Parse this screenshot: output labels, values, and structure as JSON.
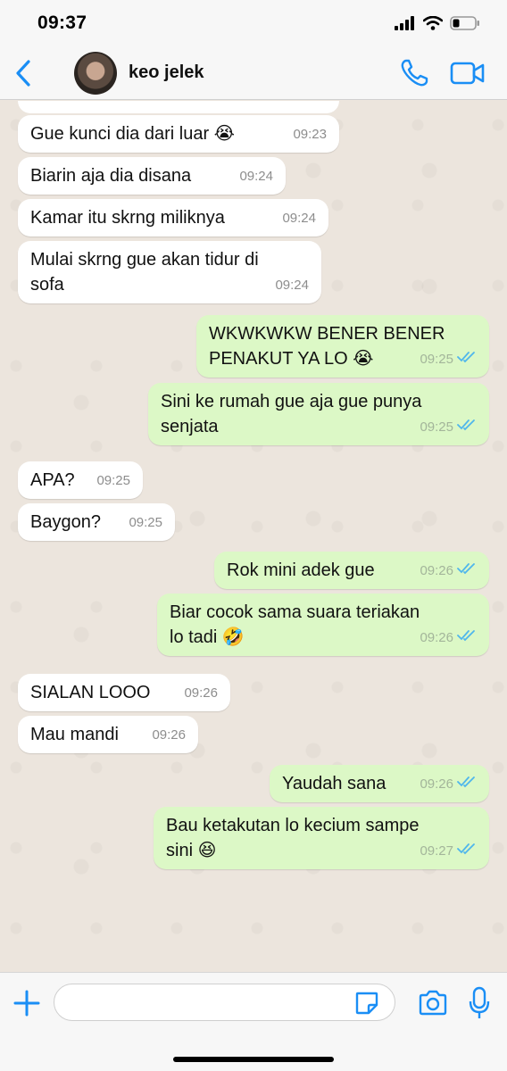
{
  "status_bar": {
    "time": "09:37"
  },
  "header": {
    "contact_name": "keo jelek"
  },
  "messages": [
    {
      "dir": "in",
      "lines": [
        "Gue kunci dia dari luar 😭"
      ],
      "time": "09:23"
    },
    {
      "dir": "in",
      "lines": [
        "Biarin aja dia disana"
      ],
      "time": "09:24"
    },
    {
      "dir": "in",
      "lines": [
        "Kamar itu skrng miliknya"
      ],
      "time": "09:24"
    },
    {
      "dir": "in",
      "lines": [
        "Mulai skrng gue akan tidur di",
        "sofa"
      ],
      "time": "09:24"
    },
    {
      "dir": "out",
      "lines": [
        "WKWKWKW BENER BENER",
        "PENAKUT YA LO 😭"
      ],
      "time": "09:25"
    },
    {
      "dir": "out",
      "lines": [
        "Sini ke rumah gue aja gue punya",
        "senjata"
      ],
      "time": "09:25"
    },
    {
      "dir": "in",
      "lines": [
        "APA?"
      ],
      "time": "09:25"
    },
    {
      "dir": "in",
      "lines": [
        "Baygon?"
      ],
      "time": "09:25"
    },
    {
      "dir": "out",
      "lines": [
        "Rok mini adek gue"
      ],
      "time": "09:26"
    },
    {
      "dir": "out",
      "lines": [
        "Biar cocok sama suara teriakan",
        "lo tadi 🤣"
      ],
      "time": "09:26"
    },
    {
      "dir": "in",
      "lines": [
        "SIALAN LOOO"
      ],
      "time": "09:26"
    },
    {
      "dir": "in",
      "lines": [
        "Mau mandi"
      ],
      "time": "09:26"
    },
    {
      "dir": "out",
      "lines": [
        "Yaudah sana"
      ],
      "time": "09:26"
    },
    {
      "dir": "out",
      "lines": [
        "Bau ketakutan lo kecium sampe",
        "sini 😆"
      ],
      "time": "09:27"
    }
  ],
  "input": {
    "placeholder": ""
  },
  "icons": {
    "back": "chevron-left-icon",
    "call": "phone-icon",
    "video": "video-camera-icon",
    "plus": "plus-icon",
    "sticker": "sticker-icon",
    "camera": "camera-icon",
    "mic": "microphone-icon"
  },
  "colors": {
    "accent": "#1a8ef5",
    "incoming": "#ffffff",
    "outgoing": "#dcf8c6",
    "read_tick": "#4fb6ec"
  }
}
